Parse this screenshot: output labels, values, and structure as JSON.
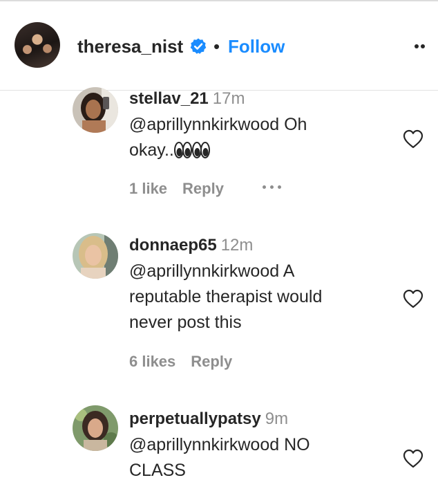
{
  "header": {
    "username": "theresa_nist",
    "separator": "•",
    "follow_label": "Follow",
    "verified_icon": "verified-badge-icon",
    "more_icon": "more-options-icon"
  },
  "comments": [
    {
      "username": "stellav_21",
      "time": "17m",
      "lines": [
        "@aprillynnkirkwood Oh",
        "okay.."
      ],
      "emoji": "👀👀",
      "likes": "1 like",
      "reply_label": "Reply",
      "show_more": true
    },
    {
      "username": "donnaep65",
      "time": "12m",
      "lines": [
        "@aprillynnkirkwood A",
        "reputable therapist would",
        "never post this"
      ],
      "likes": "6 likes",
      "reply_label": "Reply",
      "show_more": false
    },
    {
      "username": "perpetuallypatsy",
      "time": "9m",
      "lines": [
        "@aprillynnkirkwood NO",
        "CLASS"
      ],
      "show_more": false
    }
  ],
  "colors": {
    "accent": "#1a8cff",
    "text": "#262626",
    "muted": "#8e8e8e"
  }
}
